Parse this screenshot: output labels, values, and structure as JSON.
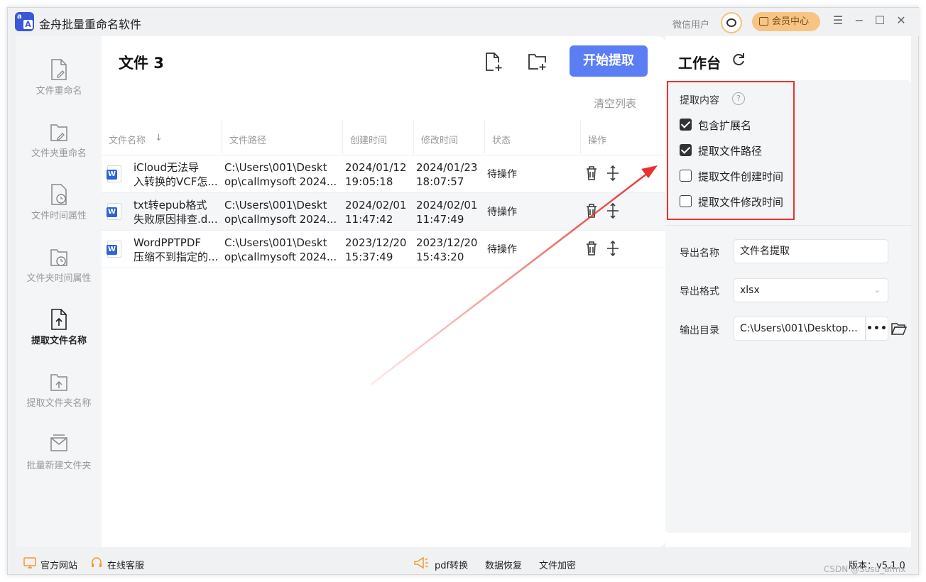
{
  "titlebar": {
    "app_title": "金舟批量重命名软件",
    "logo_text_top": "a",
    "logo_text_bottom": "A",
    "user_name": "微信用户",
    "vip_label": "会员中心",
    "minimize": "−",
    "maximize": "☐",
    "close": "✕",
    "menu": "☰"
  },
  "sidebar": {
    "items": [
      {
        "label": "文件重命名",
        "icon": "file-edit-icon"
      },
      {
        "label": "文件夹重命名",
        "icon": "folder-edit-icon"
      },
      {
        "label": "文件时间属性",
        "icon": "file-clock-icon"
      },
      {
        "label": "文件夹时间属性",
        "icon": "folder-clock-icon"
      },
      {
        "label": "提取文件名称",
        "icon": "file-upload-icon",
        "active": true
      },
      {
        "label": "提取文件夹名称",
        "icon": "folder-upload-icon"
      },
      {
        "label": "批量新建文件夹",
        "icon": "new-folder-icon"
      }
    ]
  },
  "main": {
    "title": "文件 3",
    "start_button": "开始提取",
    "clear_list": "清空列表",
    "columns": [
      "文件名称",
      "文件路径",
      "创建时间",
      "修改时间",
      "状态",
      "操作"
    ],
    "sort_arrow": "↓",
    "rows": [
      {
        "name_l1": "iCloud无法导",
        "name_l2": "入转换的VCF怎...",
        "path_l1": "C:\\Users\\001\\Deskt",
        "path_l2": "op\\callmysoft 2024...",
        "created_l1": "2024/01/12",
        "created_l2": "19:05:18",
        "modified_l1": "2024/01/23",
        "modified_l2": "18:07:57",
        "status": "待操作"
      },
      {
        "name_l1": "txt转epub格式",
        "name_l2": "失败原因排查.d...",
        "path_l1": "C:\\Users\\001\\Deskt",
        "path_l2": "op\\callmysoft 2024...",
        "created_l1": "2024/02/01",
        "created_l2": "11:47:42",
        "modified_l1": "2024/02/01",
        "modified_l2": "11:47:49",
        "status": "待操作"
      },
      {
        "name_l1": "WordPPTPDF",
        "name_l2": "压缩不到指定的...",
        "path_l1": "C:\\Users\\001\\Deskt",
        "path_l2": "op\\callmysoft 2024...",
        "created_l1": "2023/12/20",
        "created_l2": "15:37:49",
        "modified_l1": "2023/12/20",
        "modified_l2": "15:43:20",
        "status": "待操作"
      }
    ],
    "word_icon_letter": "W"
  },
  "workbench": {
    "title": "工作台",
    "extract_label": "提取内容",
    "help": "?",
    "options": [
      {
        "label": "包含扩展名",
        "checked": true
      },
      {
        "label": "提取文件路径",
        "checked": true
      },
      {
        "label": "提取文件创建时间",
        "checked": false
      },
      {
        "label": "提取文件修改时间",
        "checked": false
      }
    ],
    "export_name_label": "导出名称",
    "export_name_value": "文件名提取",
    "export_format_label": "导出格式",
    "export_format_value": "xlsx",
    "output_dir_label": "输出目录",
    "output_dir_value": "C:\\Users\\001\\Desktop...",
    "dots": "•••",
    "chevron": "⌄"
  },
  "footer": {
    "official_site": "官方网站",
    "online_service": "在线客服",
    "pdf_convert": "pdf转换",
    "data_recovery": "数据恢复",
    "file_encrypt": "文件加密",
    "version": "版本：v5.1.0"
  },
  "watermark": "CSDN @Susu_afmx",
  "colors": {
    "accent": "#5b7ef5",
    "highlight_frame": "#e8322c",
    "vip": "#f7c583"
  }
}
